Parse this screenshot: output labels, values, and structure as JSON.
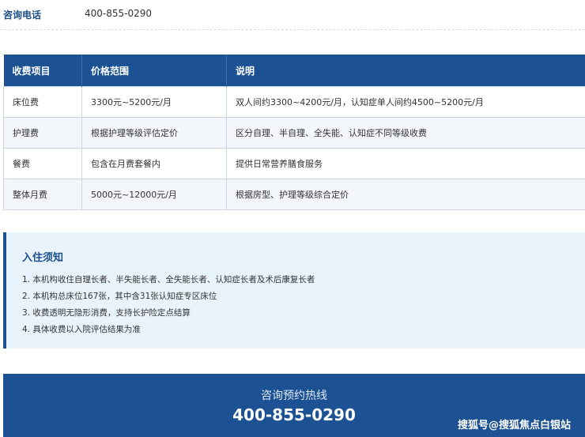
{
  "consult": {
    "label": "咨询电话",
    "value": "400-855-0290"
  },
  "fee_table": {
    "headers": [
      "收费项目",
      "价格范围",
      "说明"
    ],
    "rows": [
      [
        "床位费",
        "3300元~5200元/月",
        "双人间约3300~4200元/月，认知症单人间约4500~5200元/月"
      ],
      [
        "护理费",
        "根据护理等级评估定价",
        "区分自理、半自理、全失能、认知症不同等级收费"
      ],
      [
        "餐费",
        "包含在月费套餐内",
        "提供日常营养膳食服务"
      ],
      [
        "整体月费",
        "5000元~12000元/月",
        "根据房型、护理等级综合定价"
      ]
    ]
  },
  "notice": {
    "title": "入住须知",
    "items": [
      "1. 本机构收住自理长者、半失能长者、全失能长者、认知症长者及术后康复长者",
      "2. 本机构总床位167张，其中含31张认知症专区床位",
      "3. 收费透明无隐形消费，支持长护险定点结算",
      "4. 具体收费以入院评估结果为准"
    ]
  },
  "hotline": {
    "label": "咨询预约热线",
    "phone": "400-855-0290"
  },
  "watermark": "搜狐号@搜狐焦点白银站"
}
